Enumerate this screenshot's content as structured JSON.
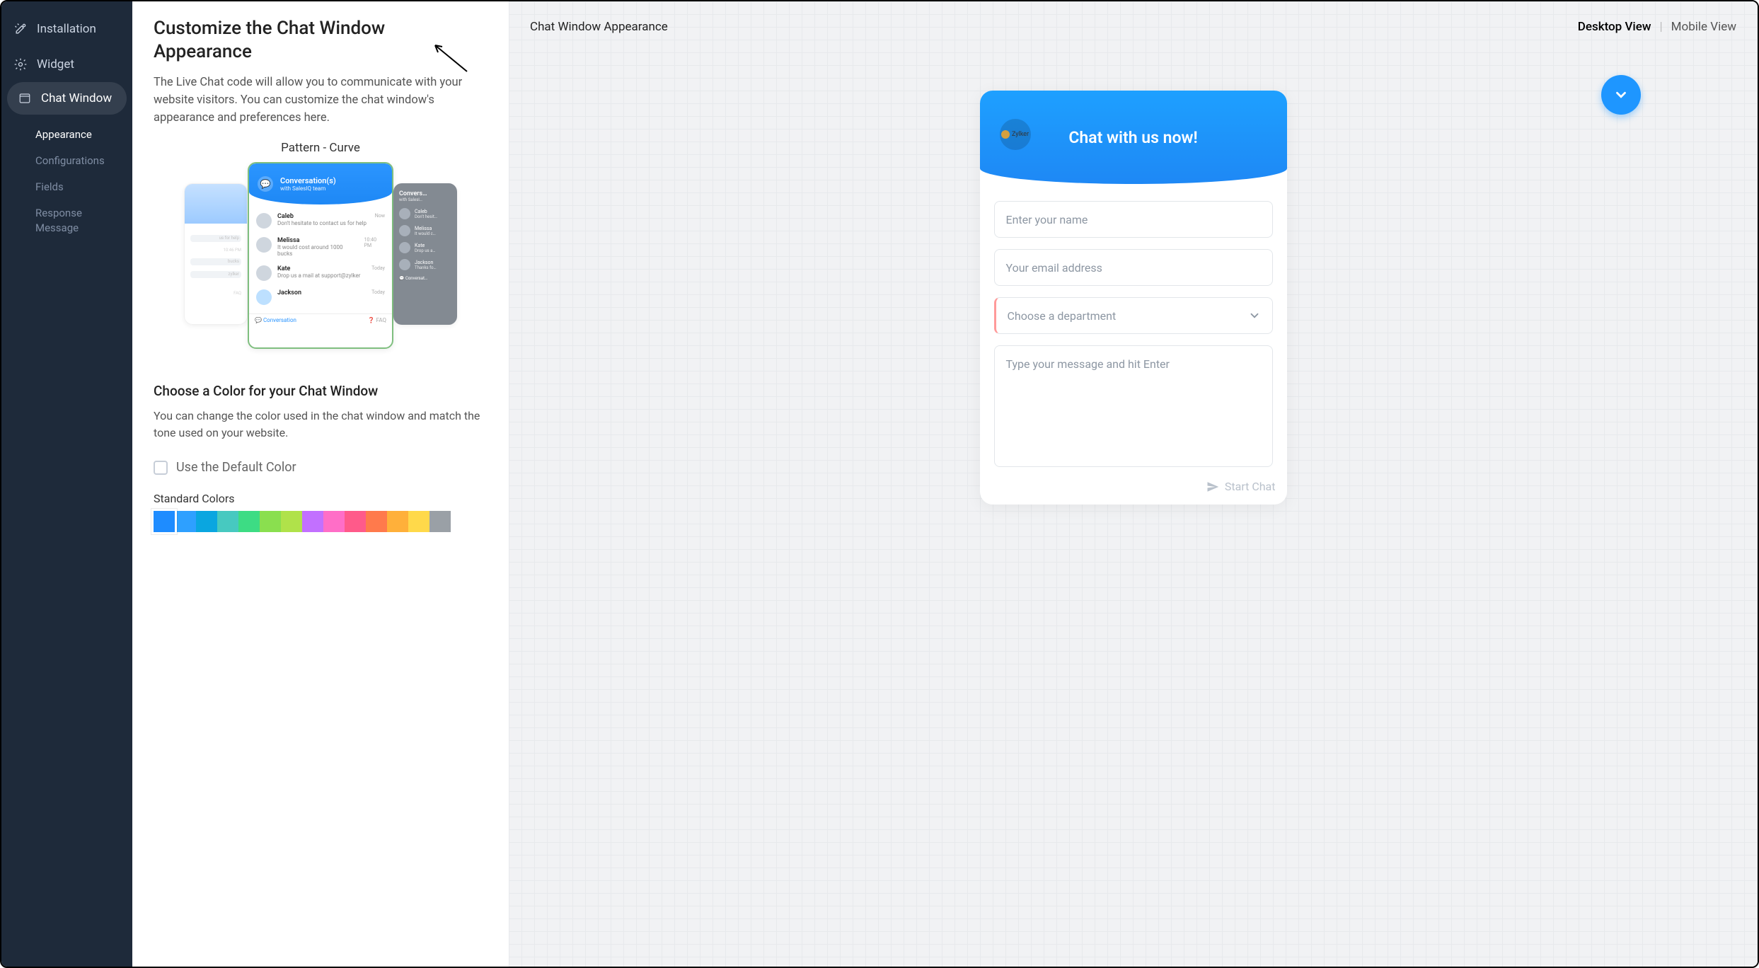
{
  "sidebar": {
    "items": [
      {
        "label": "Installation"
      },
      {
        "label": "Widget"
      },
      {
        "label": "Chat Window"
      }
    ],
    "subitems": [
      {
        "label": "Appearance"
      },
      {
        "label": "Configurations"
      },
      {
        "label": "Fields"
      },
      {
        "label": "Response Message"
      }
    ]
  },
  "config": {
    "title": "Customize the Chat Window Appearance",
    "desc": "The Live Chat code will allow you to communicate with your website visitors. You can customize the chat window's appearance and preferences here.",
    "pattern_label": "Pattern - Curve",
    "center_preview": {
      "title": "Conversation(s)",
      "subtitle": "with SalesIQ team",
      "items": [
        {
          "name": "Caleb",
          "msg": "Don't hesitate to contact us for help",
          "time": "Now"
        },
        {
          "name": "Melissa",
          "msg": "It would cost around 1000 bucks",
          "time": "10:40 PM"
        },
        {
          "name": "Kate",
          "msg": "Drop us a mail at support@zylker",
          "time": "Today"
        },
        {
          "name": "Jackson",
          "msg": "",
          "time": "Today"
        }
      ],
      "foot_left": "Conversation",
      "foot_right": "FAQ"
    },
    "color_heading": "Choose a Color for your Chat Window",
    "color_desc": "You can change the color used in the chat window and match the tone used on your website.",
    "default_color_label": "Use the Default Color",
    "swatch_label": "Standard Colors",
    "swatches": [
      "#1e8cff",
      "#2ea0ff",
      "#0aa6e0",
      "#47c9c0",
      "#3ddc84",
      "#8adf4f",
      "#b0e24a",
      "#c270ff",
      "#ff6ec7",
      "#ff5a8a",
      "#ff7a4c",
      "#ffb03a",
      "#ffd94a",
      "#9aa0a6"
    ]
  },
  "preview": {
    "header": "Chat Window Appearance",
    "views": {
      "desktop": "Desktop View",
      "mobile": "Mobile View"
    },
    "chat": {
      "brand": "Zylker",
      "title": "Chat with us now!",
      "name_ph": "Enter your name",
      "email_ph": "Your email address",
      "dept_ph": "Choose a department",
      "msg_ph": "Type your message and hit Enter",
      "start": "Start Chat"
    }
  }
}
